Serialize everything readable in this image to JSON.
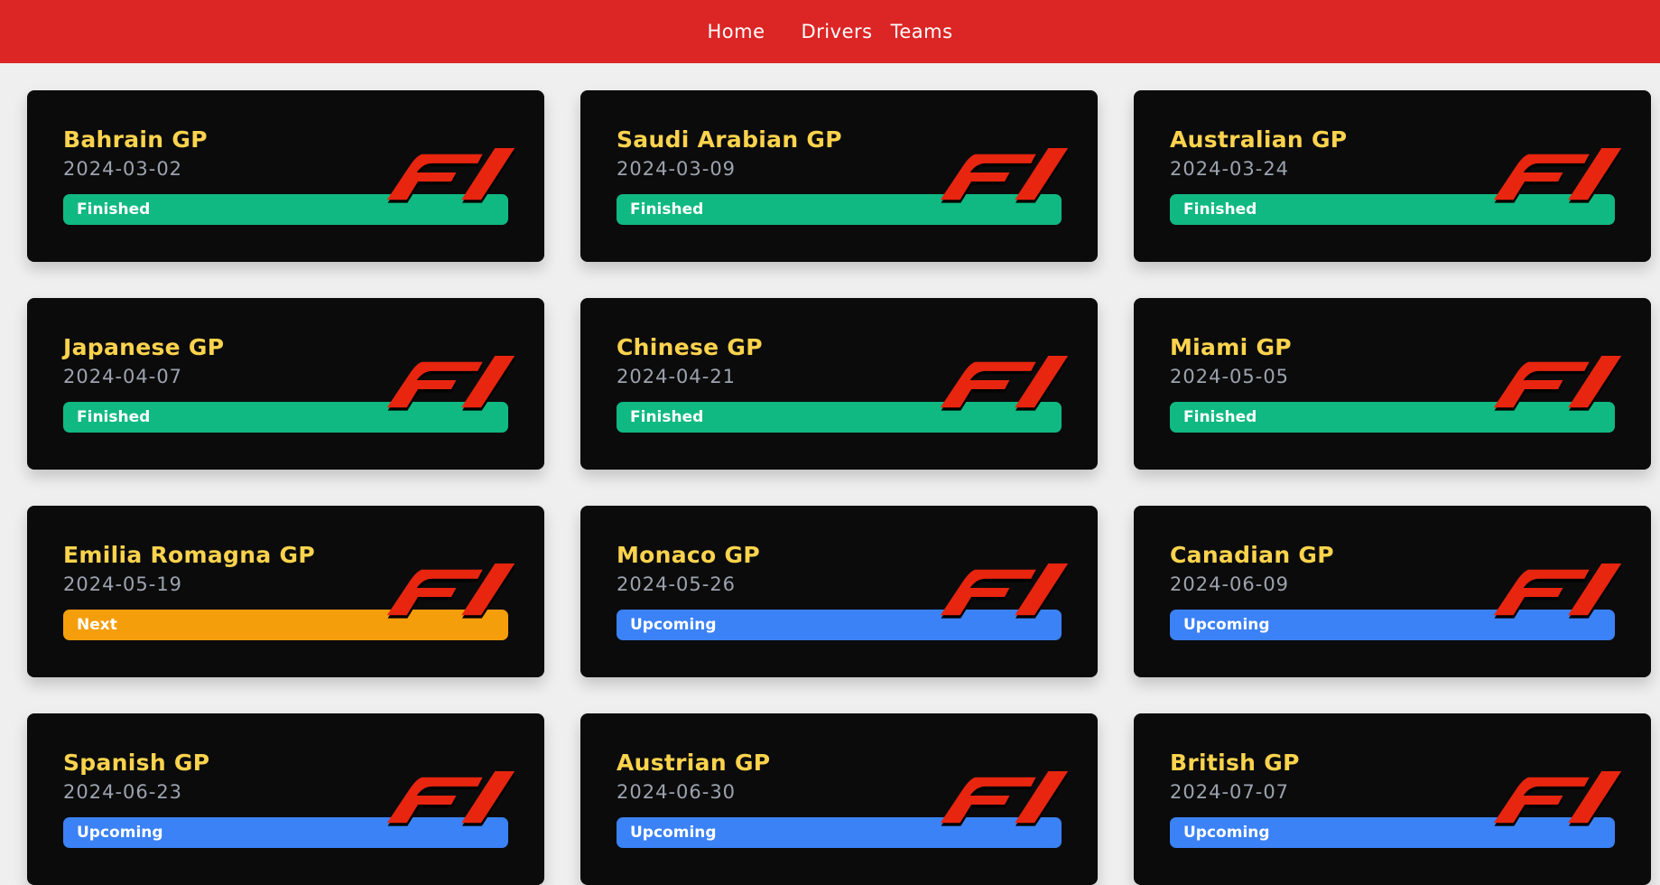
{
  "nav": {
    "home": "Home",
    "drivers": "Drivers",
    "teams": "Teams"
  },
  "colors": {
    "navbar": "#dc2626",
    "card_bg": "#0b0b0b",
    "title": "#fcd34d",
    "date": "#9ca3af",
    "logo_red": "#e8250f",
    "Finished": "#10b981",
    "Next": "#f59e0b",
    "Upcoming": "#3b82f6"
  },
  "races": [
    {
      "name": "Bahrain GP",
      "date": "2024-03-02",
      "status": "Finished"
    },
    {
      "name": "Saudi Arabian GP",
      "date": "2024-03-09",
      "status": "Finished"
    },
    {
      "name": "Australian GP",
      "date": "2024-03-24",
      "status": "Finished"
    },
    {
      "name": "Japanese GP",
      "date": "2024-04-07",
      "status": "Finished"
    },
    {
      "name": "Chinese GP",
      "date": "2024-04-21",
      "status": "Finished"
    },
    {
      "name": "Miami GP",
      "date": "2024-05-05",
      "status": "Finished"
    },
    {
      "name": "Emilia Romagna GP",
      "date": "2024-05-19",
      "status": "Next"
    },
    {
      "name": "Monaco GP",
      "date": "2024-05-26",
      "status": "Upcoming"
    },
    {
      "name": "Canadian GP",
      "date": "2024-06-09",
      "status": "Upcoming"
    },
    {
      "name": "Spanish GP",
      "date": "2024-06-23",
      "status": "Upcoming"
    },
    {
      "name": "Austrian GP",
      "date": "2024-06-30",
      "status": "Upcoming"
    },
    {
      "name": "British GP",
      "date": "2024-07-07",
      "status": "Upcoming"
    }
  ]
}
